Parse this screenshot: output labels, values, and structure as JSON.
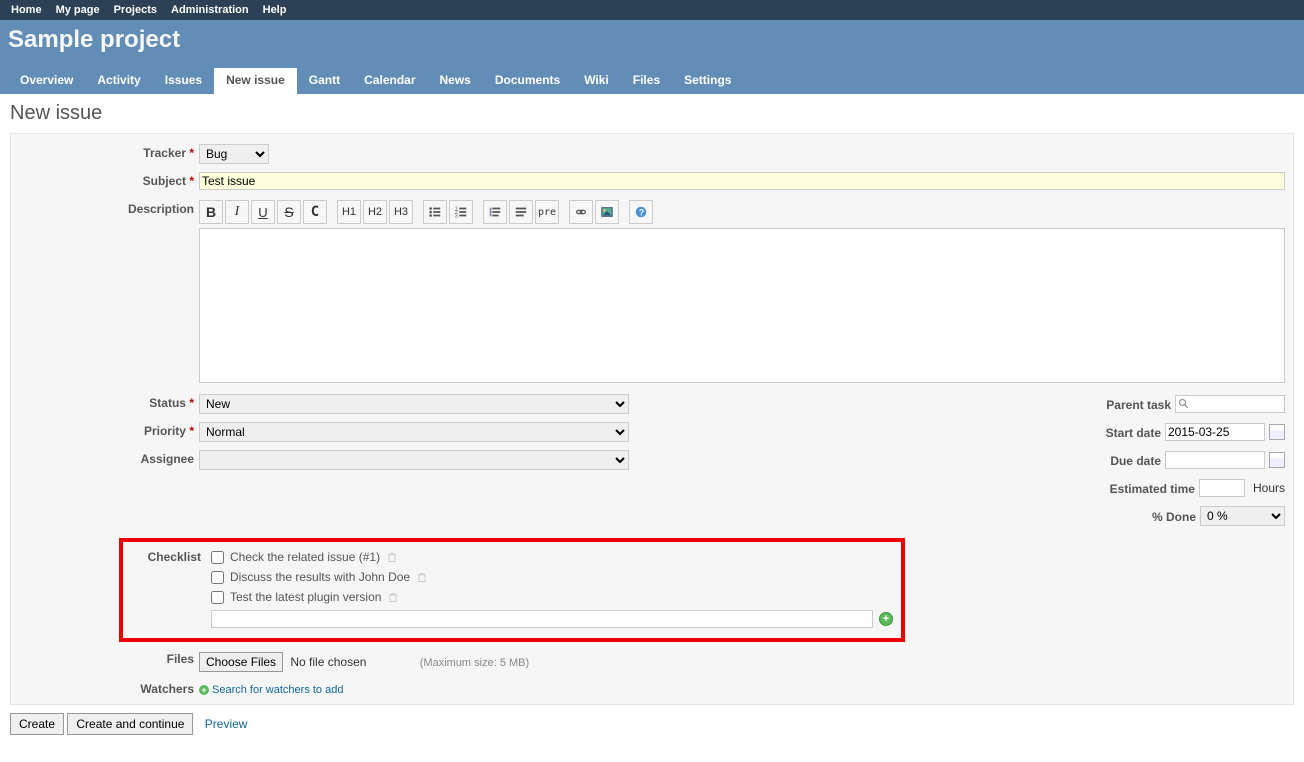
{
  "topMenu": [
    "Home",
    "My page",
    "Projects",
    "Administration",
    "Help"
  ],
  "projectTitle": "Sample project",
  "mainMenu": [
    {
      "label": "Overview",
      "selected": false
    },
    {
      "label": "Activity",
      "selected": false
    },
    {
      "label": "Issues",
      "selected": false
    },
    {
      "label": "New issue",
      "selected": true
    },
    {
      "label": "Gantt",
      "selected": false
    },
    {
      "label": "Calendar",
      "selected": false
    },
    {
      "label": "News",
      "selected": false
    },
    {
      "label": "Documents",
      "selected": false
    },
    {
      "label": "Wiki",
      "selected": false
    },
    {
      "label": "Files",
      "selected": false
    },
    {
      "label": "Settings",
      "selected": false
    }
  ],
  "pageTitle": "New issue",
  "labels": {
    "tracker": "Tracker",
    "subject": "Subject",
    "description": "Description",
    "status": "Status",
    "priority": "Priority",
    "assignee": "Assignee",
    "parentTask": "Parent task",
    "startDate": "Start date",
    "dueDate": "Due date",
    "estimatedTime": "Estimated time",
    "percentDone": "% Done",
    "checklist": "Checklist",
    "files": "Files",
    "watchers": "Watchers",
    "required": "*"
  },
  "values": {
    "tracker": "Bug",
    "subject": "Test issue",
    "description": "",
    "status": "New",
    "priority": "Normal",
    "assignee": "",
    "parentTask": "",
    "startDate": "2015-03-25",
    "dueDate": "",
    "estimatedTime": "",
    "percentDone": "0 %",
    "hoursUnit": "Hours"
  },
  "checklistItems": [
    "Check the related issue (#1)",
    "Discuss the results with John Doe",
    "Test the latest plugin version"
  ],
  "files": {
    "chooseFilesLabel": "Choose Files",
    "noFileChosen": "No file chosen",
    "maxSize": "(Maximum size: 5 MB)"
  },
  "watchersSearch": "Search for watchers to add",
  "buttons": {
    "create": "Create",
    "createAndContinue": "Create and continue",
    "preview": "Preview"
  },
  "toolbar": {
    "bold": "B",
    "italic": "I",
    "underline": "U",
    "strike": "S",
    "code": "C",
    "h1": "H1",
    "h2": "H2",
    "h3": "H3",
    "pre": "pre"
  }
}
